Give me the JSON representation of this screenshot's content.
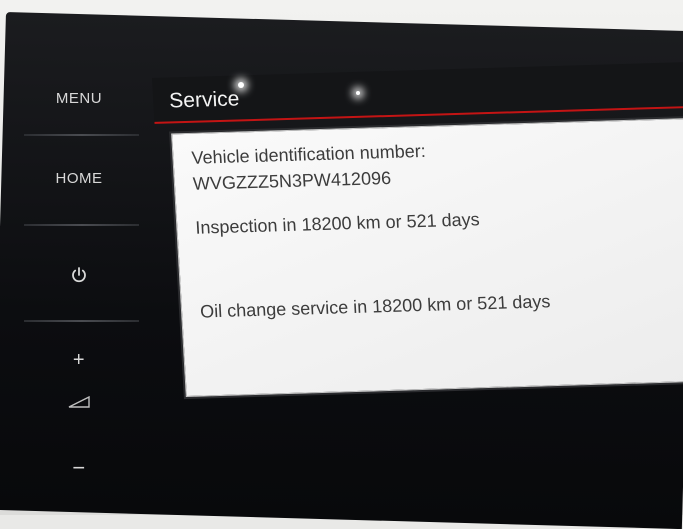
{
  "side_buttons": {
    "menu": "MENU",
    "home": "HOME",
    "power_icon": "power-icon",
    "plus": "+",
    "volume_icon": "volume-icon",
    "minus": "−"
  },
  "screen": {
    "title": "Service",
    "vin_label": "Vehicle identification number:",
    "vin_value": "WVGZZZ5N3PW412096",
    "inspection": "Inspection in 18200 km or 521 days",
    "oil_change": "Oil change service in 18200 km or 521 days"
  },
  "colors": {
    "accent_red": "#c41414",
    "bezel": "#121316",
    "panel": "#f3f3f3"
  }
}
